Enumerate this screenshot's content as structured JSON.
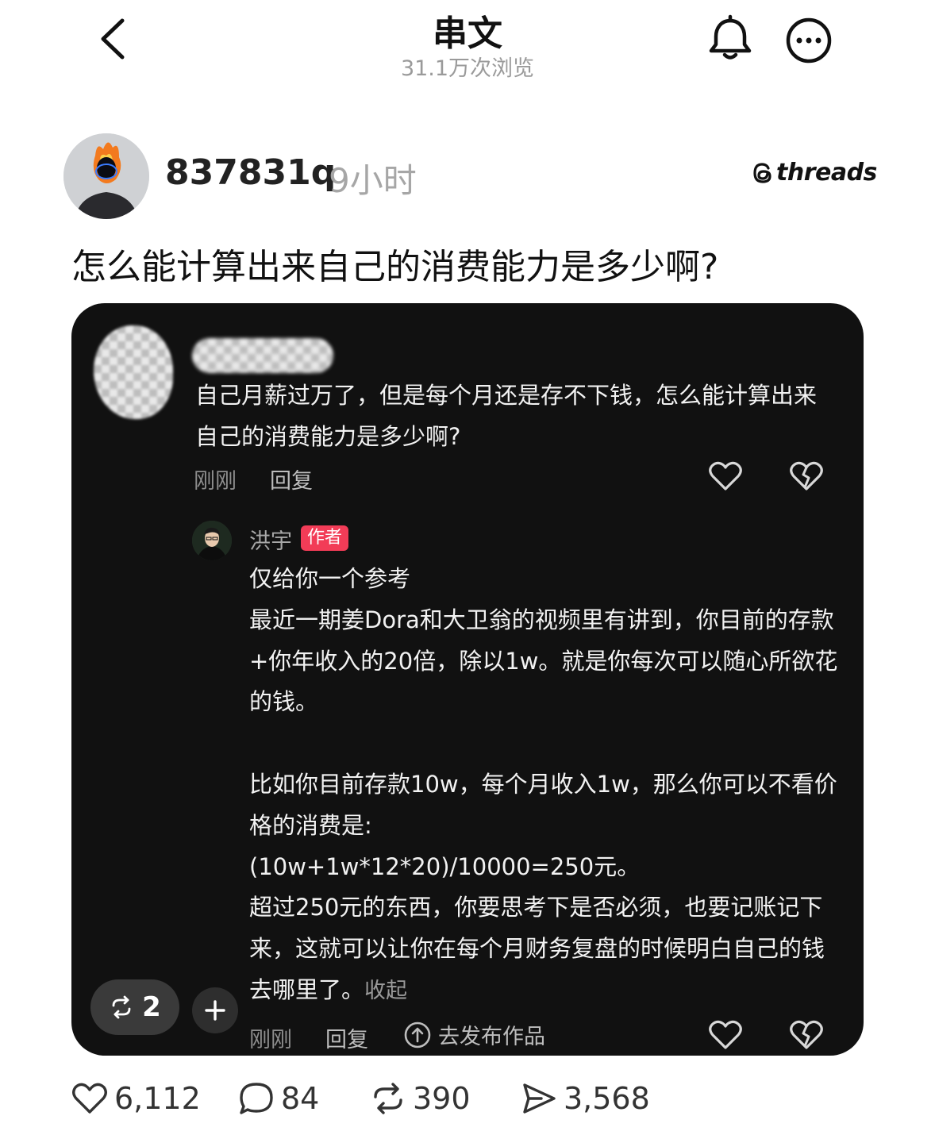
{
  "header": {
    "title": "串文",
    "views": "31.1万次浏览",
    "back_icon": "chevron-left-icon",
    "bell_icon": "bell-icon",
    "more_icon": "more-icon"
  },
  "post": {
    "username": "837831q",
    "time": "9小时",
    "brand": "threads",
    "text": "怎么能计算出来自己的消费能力是多少啊?"
  },
  "card": {
    "comment": {
      "text": "自己月薪过万了，但是每个月还是存不下钱，怎么能计算出来自己的消费能力是多少啊?",
      "time": "刚刚",
      "reply": "回复"
    },
    "reply": {
      "name": "洪宇",
      "badge": "作者",
      "lines": [
        "仅给你一个参考",
        "最近一期姜Dora和大卫翁的视频里有讲到，你目前的存款+你年收入的20倍，除以1w。就是你每次可以随心所欲花的钱。",
        "",
        "比如你目前存款10w，每个月收入1w，那么你可以不看价格的消费是:",
        "(10w+1w*12*20)/10000=250元。",
        "超过250元的东西，你要思考下是否必须，也要记账记下来，这就可以让你在每个月财务复盘的时候明白自己的钱去哪里了。"
      ],
      "collapse": "收起",
      "time": "刚刚",
      "reply": "回复",
      "publish": "去发布作品"
    },
    "repost_count": "2"
  },
  "stats": {
    "likes": "6,112",
    "comments": "84",
    "reposts": "390",
    "shares": "3,568"
  }
}
